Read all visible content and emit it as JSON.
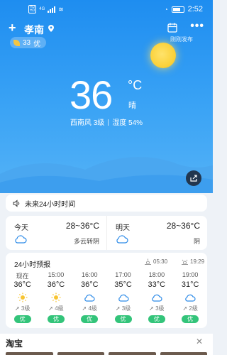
{
  "status_bar": {
    "time": "2:52",
    "network": "4G"
  },
  "header": {
    "city": "孝南",
    "publish_text": "刚刚发布",
    "aqi_value": "33",
    "aqi_label": "优"
  },
  "current": {
    "temperature": "36",
    "unit": "°C",
    "condition": "晴",
    "wind": "西南风 3级",
    "humidity": "湿度 54%"
  },
  "alert": {
    "text": "未来24小时时间"
  },
  "two_day": [
    {
      "name": "今天",
      "range": "28~36°C",
      "condition": "多云转阴",
      "icon": "cloud-icon"
    },
    {
      "name": "明天",
      "range": "28~36°C",
      "condition": "阴",
      "icon": "cloud-icon"
    }
  ],
  "hourly": {
    "title": "24小时预报",
    "sunrise": "05:30",
    "sunset": "19:29",
    "items": [
      {
        "time": "现在",
        "temp": "36°C",
        "icon": "sun-icon",
        "wind": "3级",
        "aqi": "优"
      },
      {
        "time": "15:00",
        "temp": "36°C",
        "icon": "sun-icon",
        "wind": "4级",
        "aqi": "优"
      },
      {
        "time": "16:00",
        "temp": "36°C",
        "icon": "cloud-icon",
        "wind": "4级",
        "aqi": "优"
      },
      {
        "time": "17:00",
        "temp": "35°C",
        "icon": "cloud-icon",
        "wind": "3级",
        "aqi": "优"
      },
      {
        "time": "18:00",
        "temp": "33°C",
        "icon": "cloud-icon",
        "wind": "3级",
        "aqi": "优"
      },
      {
        "time": "19:00",
        "temp": "31°C",
        "icon": "cloud-icon",
        "wind": "2级",
        "aqi": "优"
      }
    ]
  },
  "ad": {
    "title": "淘宝",
    "close": "✕"
  },
  "colors": {
    "hero_top": "#1e8df0",
    "aqi_good": "#33c47a",
    "sun": "#fbd23c"
  }
}
